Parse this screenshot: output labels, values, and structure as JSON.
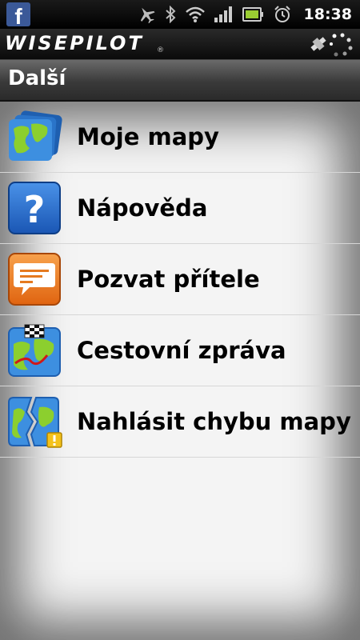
{
  "status_bar": {
    "notification_icon": "facebook-icon",
    "icons": [
      "airplane-icon",
      "bluetooth-icon",
      "wifi-icon",
      "signal-icon",
      "battery-icon",
      "alarm-icon"
    ],
    "time": "18:38"
  },
  "app_header": {
    "logo_text": "WISEPILOT",
    "logo_mark": "®",
    "gps_icon": "satellite-icon"
  },
  "title_bar": {
    "title": "Další"
  },
  "menu": {
    "items": [
      {
        "label": "Moje mapy",
        "icon": "map-stack-icon"
      },
      {
        "label": "Nápověda",
        "icon": "help-icon"
      },
      {
        "label": "Pozvat přítele",
        "icon": "message-icon"
      },
      {
        "label": "Cestovní zpráva",
        "icon": "travel-report-icon"
      },
      {
        "label": "Nahlásit chybu mapy",
        "icon": "map-error-icon"
      }
    ]
  },
  "colors": {
    "facebook_blue": "#3b5998",
    "help_blue": "#1f66c9",
    "message_orange": "#ee7a1d",
    "map_blue": "#2d83d6",
    "land_green": "#7fbf2a"
  }
}
